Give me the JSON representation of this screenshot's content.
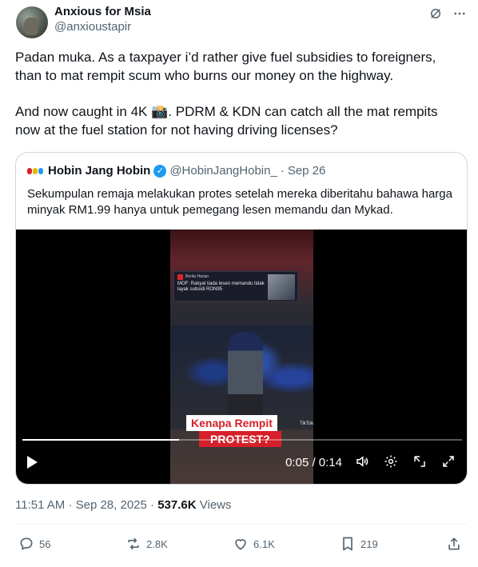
{
  "author": {
    "display_name": "Anxious for Msia",
    "handle": "@anxioustapir"
  },
  "header_icons": [
    "grok-icon",
    "more-icon"
  ],
  "tweet": {
    "paragraph_1": "Padan muka. As a taxpayer i’d rather give fuel subsidies to foreigners, than to mat rempit scum who burns our money on the highway.",
    "paragraph_2": "And now caught in 4K 📸. PDRM & KDN can catch all the mat rempits now at the fuel station for not having driving licenses?"
  },
  "quote": {
    "display_name": "Hobin Jang Hobin",
    "handle": "@HobinJangHobin_",
    "separator": "·",
    "date": "Sep 26",
    "text": "Sekumpulan remaja melakukan protes setelah mereka diberitahu bahawa harga minyak RM1.99 hanya untuk pemegang lesen memandu dan Mykad.",
    "video": {
      "inner_card_label": "Berita Harian",
      "inner_card_title": "MOF: Rakyat tiada lesen memandu tidak layak subsidi RON95",
      "caption_line_1": "Kenapa Rempit",
      "caption_line_2": "PROTEST?",
      "watermark": "TikTok",
      "time_display": "0:05 / 0:14",
      "progress": 0.357
    }
  },
  "timestamp": {
    "time": "11:51 AM",
    "separator": "·",
    "date": "Sep 28, 2025",
    "views_count": "537.6K",
    "views_label": "Views"
  },
  "actions": {
    "replies": "56",
    "reposts": "2.8K",
    "likes": "6.1K",
    "bookmarks": "219"
  },
  "colors": {
    "text_primary": "#0f1419",
    "text_secondary": "#536471",
    "border": "#cfd9de",
    "verified": "#1d9bf0",
    "caption_red": "#d5202a"
  }
}
